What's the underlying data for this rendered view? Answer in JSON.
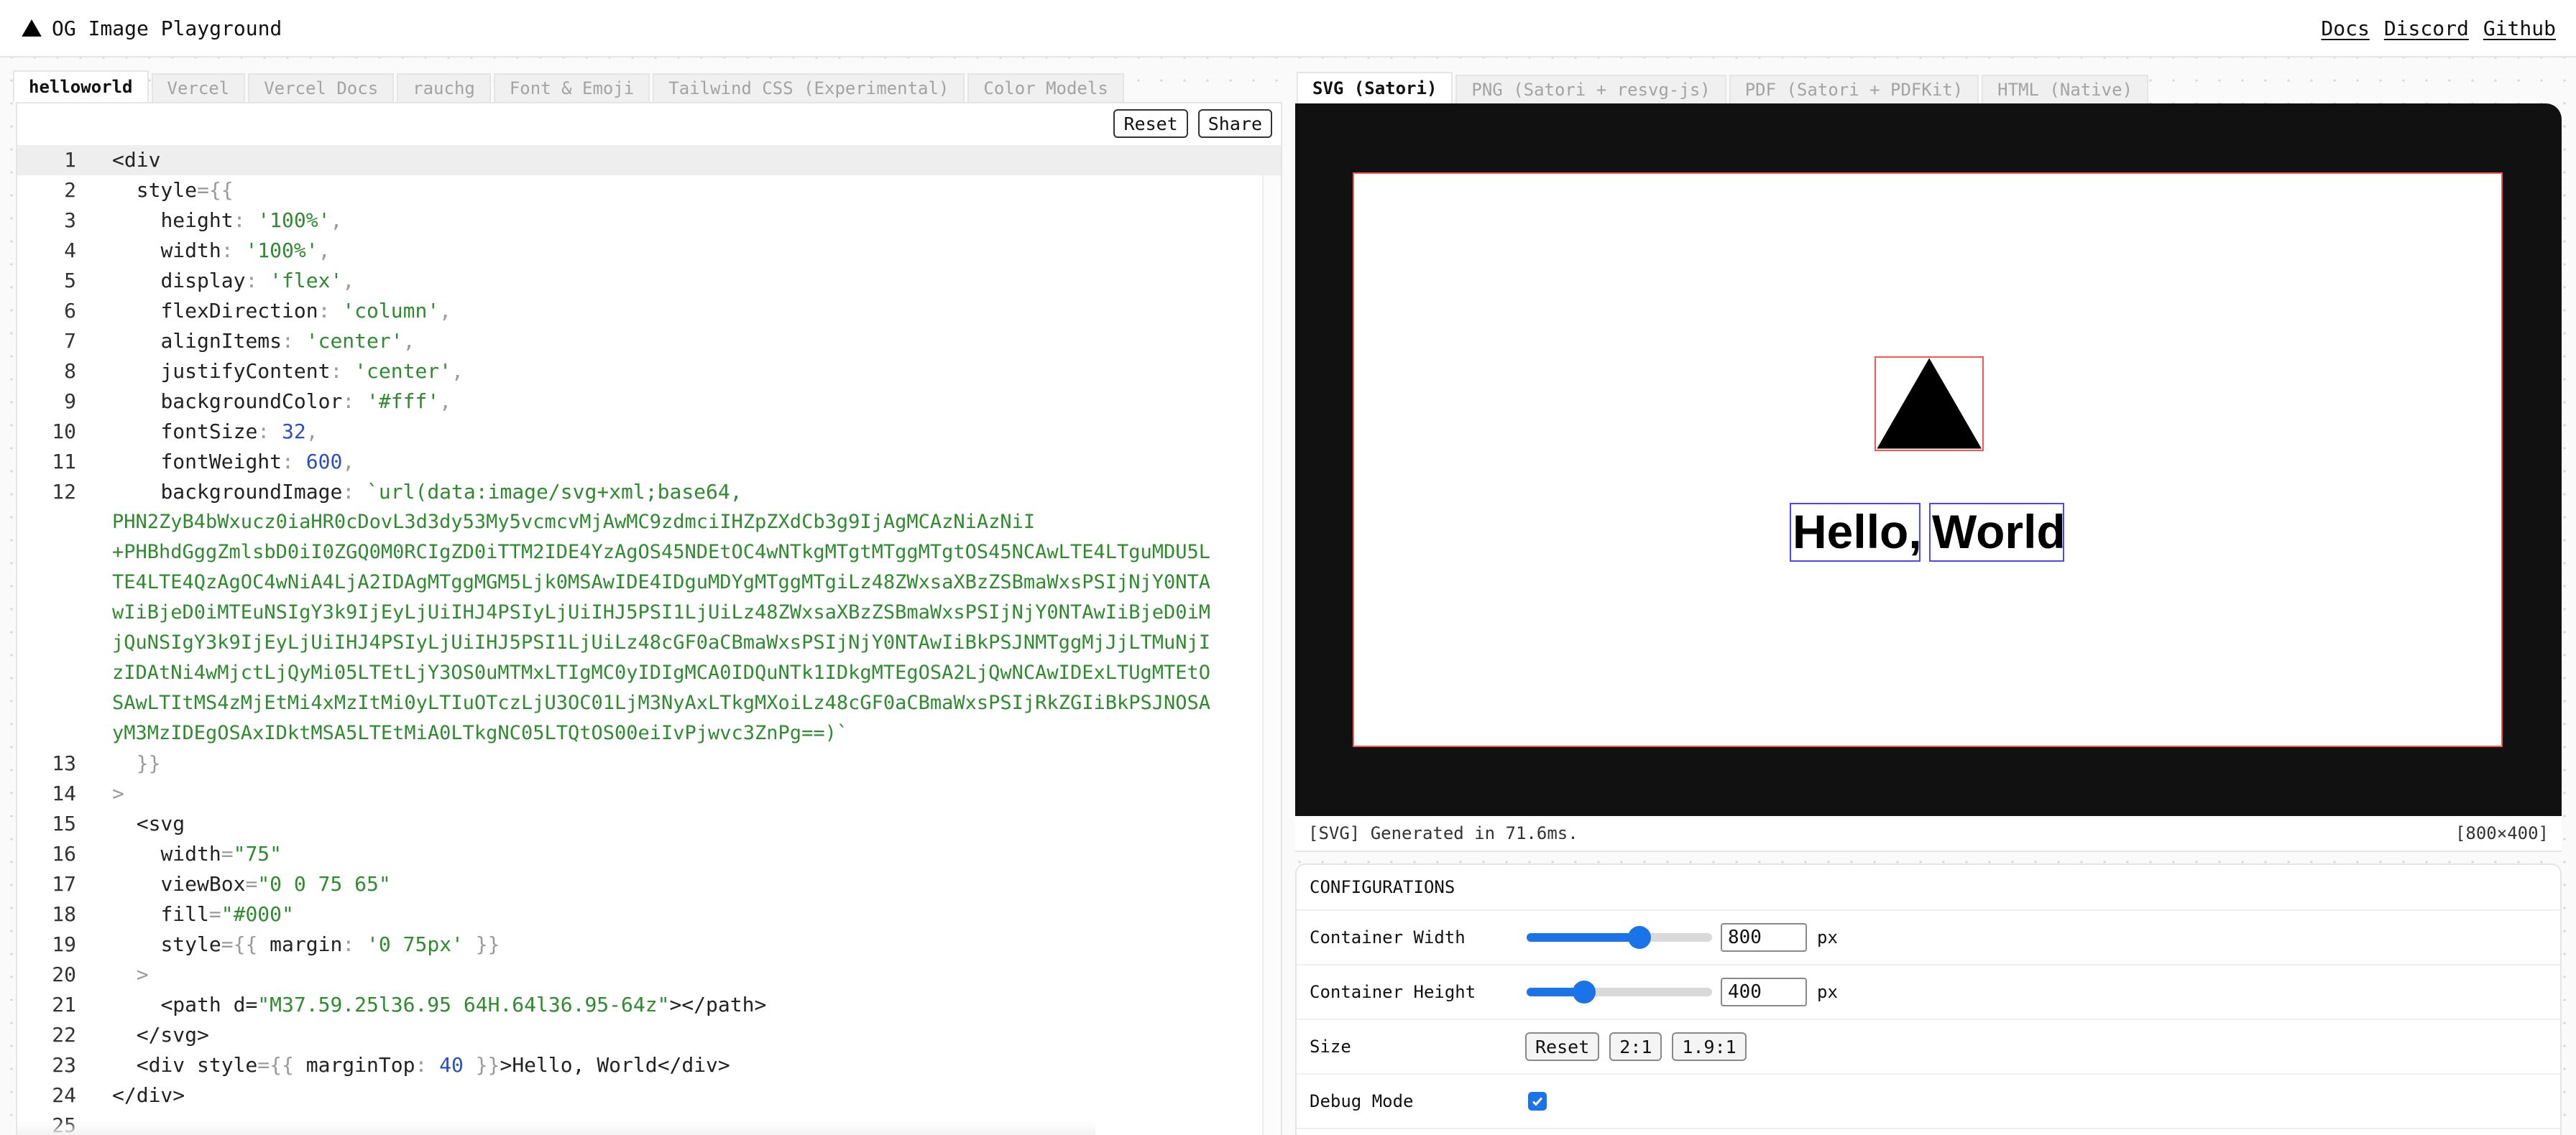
{
  "header": {
    "title": "OG Image Playground",
    "nav": [
      "Docs",
      "Discord",
      "Github"
    ]
  },
  "editor_tabs": [
    "helloworld",
    "Vercel",
    "Vercel Docs",
    "rauchg",
    "Font & Emoji",
    "Tailwind CSS (Experimental)",
    "Color Models"
  ],
  "editor_active_tab": 0,
  "editor_toolbar": {
    "reset": "Reset",
    "share": "Share"
  },
  "code": {
    "l1": "<div",
    "l2a": "style",
    "l2b": "={{",
    "l3k": "height",
    "l3v": "'100%'",
    "l4k": "width",
    "l4v": "'100%'",
    "l5k": "display",
    "l5v": "'flex'",
    "l6k": "flexDirection",
    "l6v": "'column'",
    "l7k": "alignItems",
    "l7v": "'center'",
    "l8k": "justifyContent",
    "l8v": "'center'",
    "l9k": "backgroundColor",
    "l9v": "'#fff'",
    "l10k": "fontSize",
    "l10v": "32",
    "l11k": "fontWeight",
    "l11v": "600",
    "l12k": "backgroundImage",
    "l12v": "`url(data:image/svg+xml;base64,",
    "l12wrap": [
      "PHN2ZyB4bWxucz0iaHR0cDovL3d3dy53My5vcmcvMjAwMC9zdmciIHZpZXdCb3g9IjAgMCAzNiAzNiI",
      "+PHBhdGggZmlsbD0iI0ZGQ0M0RCIgZD0iTTM2IDE4YzAgOS45NDEtOC4wNTkgMTgtMTggMTgtOS45NCAwLTE4LTguMDU5L",
      "TE4LTE4QzAgOC4wNiA4LjA2IDAgMTggMGM5Ljk0MSAwIDE4IDguMDYgMTggMTgiLz48ZWxsaXBzZSBmaWxsPSIjNjY0NTA",
      "wIiBjeD0iMTEuNSIgY3k9IjEyLjUiIHJ4PSIyLjUiIHJ5PSI1LjUiLz48ZWxsaXBzZSBmaWxsPSIjNjY0NTAwIiBjeD0iM",
      "jQuNSIgY3k9IjEyLjUiIHJ4PSIyLjUiIHJ5PSI1LjUiLz48cGF0aCBmaWxsPSIjNjY0NTAwIiBkPSJNMTggMjJjLTMuNjI",
      "zIDAtNi4wMjctLjQyMi05LTEtLjY3OS0uMTMxLTIgMC0yIDIgMCA0IDQuNTk1IDkgMTEgOSA2LjQwNCAwIDExLTUgMTEtO",
      "SAwLTItMS4zMjEtMi4xMzItMi0yLTIuOTczLjU3OC01LjM3NyAxLTkgMXoiLz48cGF0aCBmaWxsPSIjRkZGIiBkPSJNOSA",
      "yM3MzIDEgOSAxIDktMSA5LTEtMiA0LTkgNC05LTQtOS00eiIvPjwvc3ZnPg==)`"
    ],
    "l13": "}}",
    "l14": ">",
    "l15": "<svg",
    "l16k": "width",
    "l16v": "\"75\"",
    "l17k": "viewBox",
    "l17v": "\"0 0 75 65\"",
    "l18k": "fill",
    "l18v": "\"#000\"",
    "l19k": "style",
    "l19a": "={{ ",
    "l19b": "margin",
    "l19v": "'0 75px'",
    "l19c": " }}",
    "l20": ">",
    "l21a": "<path d=",
    "l21v": "\"M37.59.25l36.95 64H.64l36.95-64z\"",
    "l21b": "></path>",
    "l22": "</svg>",
    "l23a": "<div style",
    "l23b": "={{ ",
    "l23k": "marginTop",
    "l23v": "40",
    "l23c": " }}",
    "l23t": ">Hello, World",
    "l23e": "</div>",
    "l24": "</div>"
  },
  "preview_tabs": [
    "SVG (Satori)",
    "PNG (Satori + resvg-js)",
    "PDF (Satori + PDFKit)",
    "HTML (Native)"
  ],
  "preview_active_tab": 0,
  "preview": {
    "word1": "Hello,",
    "word2": "World",
    "status_left": "[SVG] Generated in 71.6ms.",
    "status_right": "[800×400]"
  },
  "config": {
    "title": "CONFIGURATIONS",
    "width_label": "Container Width",
    "width_value": "800",
    "width_fraction": 0.61,
    "height_label": "Container Height",
    "height_value": "400",
    "height_fraction": 0.31,
    "unit": "px",
    "size_label": "Size",
    "size_buttons": [
      "Reset",
      "2:1",
      "1.9:1"
    ],
    "debug_label": "Debug Mode",
    "debug_checked": true
  },
  "colors": {
    "accent": "#1a73e8",
    "debug_box": "#ff5252",
    "text_box": "#4a4af0",
    "code_string": "#2e8b2e",
    "code_number": "#2b4ec2"
  }
}
